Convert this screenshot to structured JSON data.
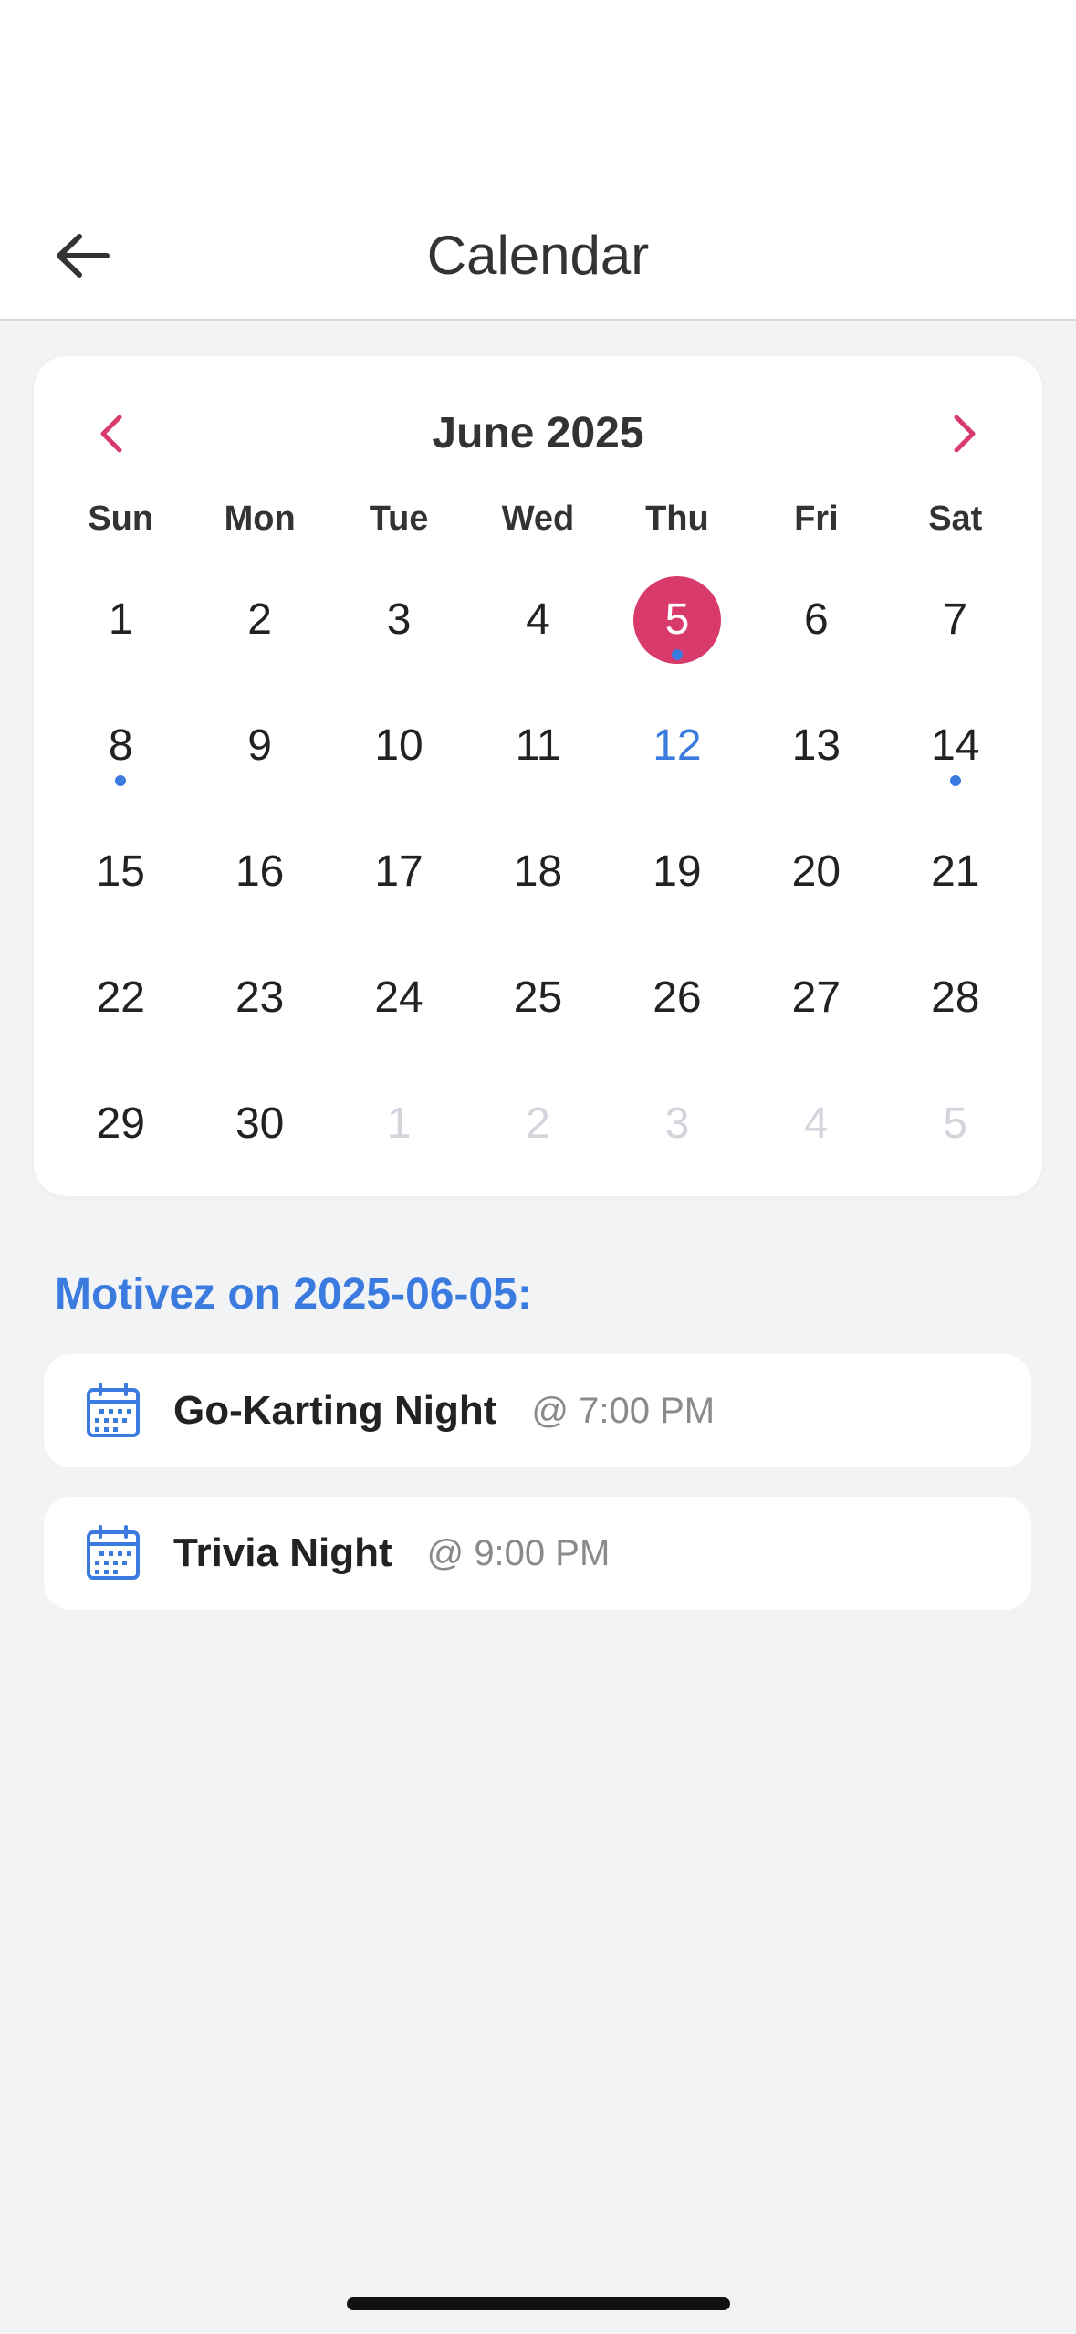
{
  "header": {
    "title": "Calendar"
  },
  "calendar": {
    "month_label": "June 2025",
    "weekdays": [
      "Sun",
      "Mon",
      "Tue",
      "Wed",
      "Thu",
      "Fri",
      "Sat"
    ],
    "days": [
      {
        "label": "1"
      },
      {
        "label": "2"
      },
      {
        "label": "3"
      },
      {
        "label": "4"
      },
      {
        "label": "5",
        "selected": true,
        "dot": true
      },
      {
        "label": "6"
      },
      {
        "label": "7"
      },
      {
        "label": "8",
        "dot": true
      },
      {
        "label": "9"
      },
      {
        "label": "10"
      },
      {
        "label": "11"
      },
      {
        "label": "12",
        "today": true
      },
      {
        "label": "13"
      },
      {
        "label": "14",
        "dot": true
      },
      {
        "label": "15"
      },
      {
        "label": "16"
      },
      {
        "label": "17"
      },
      {
        "label": "18"
      },
      {
        "label": "19"
      },
      {
        "label": "20"
      },
      {
        "label": "21"
      },
      {
        "label": "22"
      },
      {
        "label": "23"
      },
      {
        "label": "24"
      },
      {
        "label": "25"
      },
      {
        "label": "26"
      },
      {
        "label": "27"
      },
      {
        "label": "28"
      },
      {
        "label": "29"
      },
      {
        "label": "30"
      },
      {
        "label": "1",
        "muted": true
      },
      {
        "label": "2",
        "muted": true
      },
      {
        "label": "3",
        "muted": true
      },
      {
        "label": "4",
        "muted": true
      },
      {
        "label": "5",
        "muted": true
      }
    ]
  },
  "events": {
    "heading": "Motivez on 2025-06-05:",
    "items": [
      {
        "name": "Go-Karting Night",
        "time": "@ 7:00 PM"
      },
      {
        "name": "Trivia Night",
        "time": "@ 9:00 PM"
      }
    ]
  },
  "colors": {
    "accent": "#d73a6b",
    "primary": "#3b7be0",
    "background": "#f2f3f5"
  }
}
